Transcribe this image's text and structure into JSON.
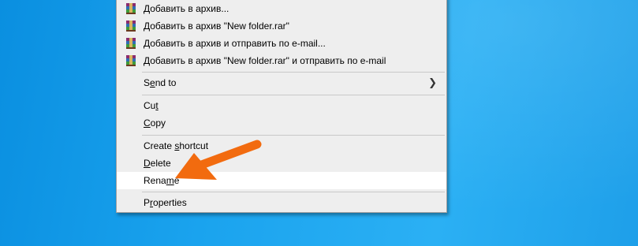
{
  "menu": {
    "items": [
      {
        "label": "Добавить в архив...",
        "icon": "winrar-icon"
      },
      {
        "label": "Добавить в архив \"New folder.rar\"",
        "icon": "winrar-icon"
      },
      {
        "label": "Добавить в архив и отправить по e-mail...",
        "icon": "winrar-icon"
      },
      {
        "label": "Добавить в архив \"New folder.rar\" и отправить по e-mail",
        "icon": "winrar-icon"
      }
    ],
    "send_to": {
      "pre": "S",
      "ul": "e",
      "post": "nd to"
    },
    "cut": {
      "pre": "Cu",
      "ul": "t",
      "post": ""
    },
    "copy": {
      "pre": "",
      "ul": "C",
      "post": "opy"
    },
    "create_shortcut": {
      "pre": "Create ",
      "ul": "s",
      "post": "hortcut"
    },
    "delete": {
      "pre": "",
      "ul": "D",
      "post": "elete"
    },
    "rename": {
      "pre": "Rena",
      "ul": "m",
      "post": "e"
    },
    "properties": {
      "pre": "P",
      "ul": "r",
      "post": "operties"
    }
  },
  "colors": {
    "desktop": "#1aa3ee",
    "menu_bg": "#eeeeee",
    "highlight": "#ffffff",
    "arrow": "#f26b0f"
  },
  "annotation": {
    "icon": "orange-arrow-icon"
  }
}
